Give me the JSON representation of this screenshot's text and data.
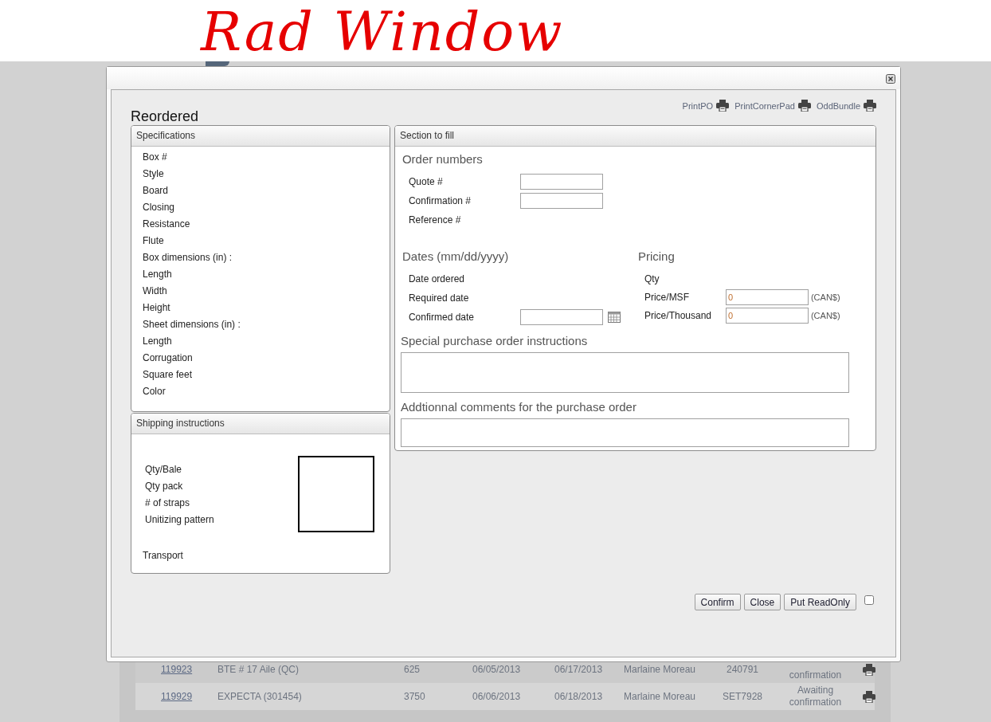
{
  "annotation": {
    "text": "Rad Window"
  },
  "background_table": {
    "rows": [
      {
        "column_1": "119923",
        "column_2": "BTE # 17 Aile (QC)",
        "column_3": "625",
        "column_4": "06/05/2013",
        "column_5": "06/17/2013",
        "column_6": "Marlaine Moreau",
        "column_7": "240791",
        "column_8": "confirmation"
      },
      {
        "column_1": "119929",
        "column_2": "EXPECTA (301454)",
        "column_3": "3750",
        "column_4": "06/06/2013",
        "column_5": "06/18/2013",
        "column_6": "Marlaine Moreau",
        "column_7": "SET7928",
        "column_8": "Awaiting confirmation"
      }
    ]
  },
  "dialog": {
    "heading": "Reordered",
    "print_links": [
      "PrintPO",
      "PrintCornerPad",
      "OddBundle"
    ],
    "specifications": {
      "title": "Specifications",
      "labels": [
        "Box #",
        "Style",
        "Board",
        "Closing",
        "Resistance",
        "Flute",
        "Box dimensions (in) :",
        "Length",
        "Width",
        "Height",
        "Sheet dimensions (in) :",
        "Length",
        "Corrugation",
        "Square feet",
        "Color"
      ]
    },
    "shipping": {
      "title": "Shipping instructions",
      "labels": [
        "Qty/Bale",
        "Qty pack",
        "# of straps",
        "Unitizing pattern"
      ],
      "transport_label": "Transport"
    },
    "section": {
      "title": "Section to fill",
      "order_numbers": {
        "heading": "Order numbers",
        "fields": [
          {
            "label": "Quote #",
            "kind": "input"
          },
          {
            "label": "Confirmation #",
            "kind": "input"
          },
          {
            "label": "Reference #",
            "kind": "text"
          }
        ]
      },
      "dates": {
        "heading": "Dates (mm/dd/yyyy)",
        "fields": [
          {
            "label": "Date ordered",
            "kind": "text"
          },
          {
            "label": "Required date",
            "kind": "text"
          },
          {
            "label": "Confirmed date",
            "kind": "date"
          }
        ]
      },
      "pricing": {
        "heading": "Pricing",
        "fields": [
          {
            "label": "Qty",
            "kind": "text"
          },
          {
            "label": "Price/MSF",
            "kind": "input",
            "value": "0",
            "unit": "(CAN$)"
          },
          {
            "label": "Price/Thousand",
            "kind": "input",
            "value": "0",
            "unit": "(CAN$)"
          }
        ]
      },
      "special_instructions": {
        "heading": "Special purchase order instructions"
      },
      "additional_comments": {
        "heading": "Addtionnal comments for the purchase order"
      }
    },
    "buttons": [
      "Confirm",
      "Close",
      "Put ReadOnly"
    ],
    "readonly_checkbox": {
      "checked": false
    }
  }
}
